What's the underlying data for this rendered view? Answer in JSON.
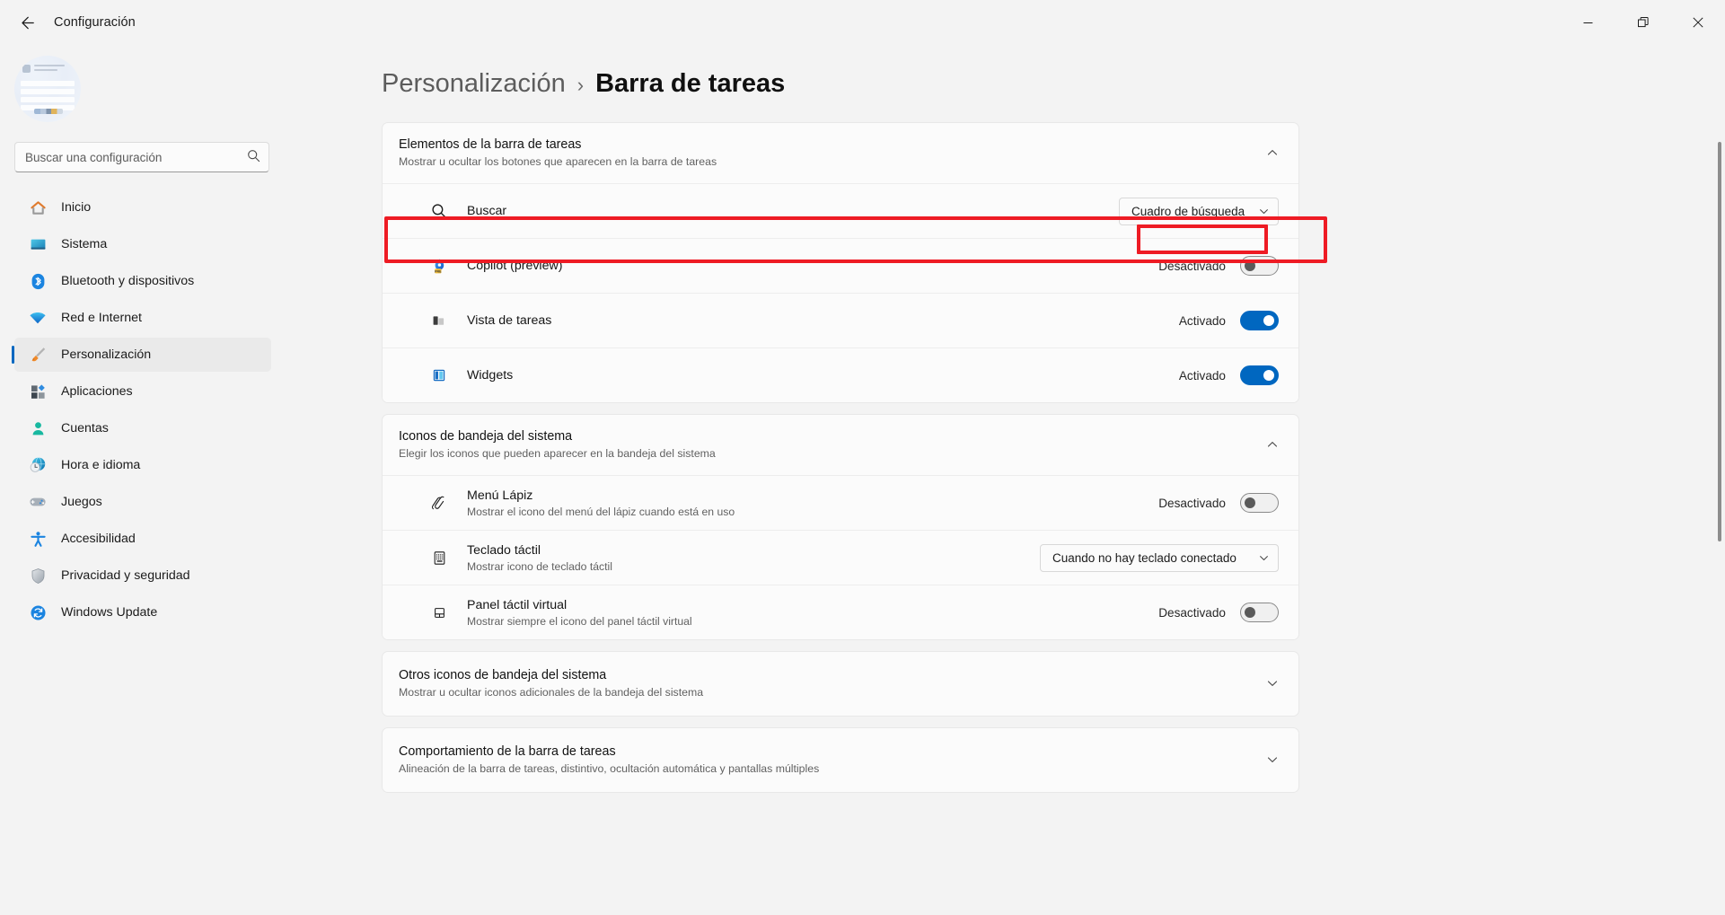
{
  "titlebar": {
    "back_tooltip": "Atrás",
    "app_title": "Configuración",
    "minimize_label": "Minimizar",
    "maximize_label": "Restaurar",
    "close_label": "Cerrar"
  },
  "sidebar": {
    "search_placeholder": "Buscar una configuración",
    "search_value": "",
    "items": [
      {
        "label": "Inicio",
        "icon": "home-icon",
        "active": false
      },
      {
        "label": "Sistema",
        "icon": "display-icon",
        "active": false
      },
      {
        "label": "Bluetooth y dispositivos",
        "icon": "bluetooth-icon",
        "active": false
      },
      {
        "label": "Red e Internet",
        "icon": "wifi-icon",
        "active": false
      },
      {
        "label": "Personalización",
        "icon": "paintbrush-icon",
        "active": true
      },
      {
        "label": "Aplicaciones",
        "icon": "apps-icon",
        "active": false
      },
      {
        "label": "Cuentas",
        "icon": "person-icon",
        "active": false
      },
      {
        "label": "Hora e idioma",
        "icon": "clock-globe-icon",
        "active": false
      },
      {
        "label": "Juegos",
        "icon": "gamepad-icon",
        "active": false
      },
      {
        "label": "Accesibilidad",
        "icon": "accessibility-icon",
        "active": false
      },
      {
        "label": "Privacidad y seguridad",
        "icon": "shield-icon",
        "active": false
      },
      {
        "label": "Windows Update",
        "icon": "update-icon",
        "active": false
      }
    ]
  },
  "breadcrumb": {
    "parent": "Personalización",
    "separator": "›",
    "current": "Barra de tareas"
  },
  "sections": {
    "taskbar_items": {
      "title": "Elementos de la barra de tareas",
      "subtitle": "Mostrar u ocultar los botones que aparecen en la barra de tareas",
      "expanded": true,
      "rows": {
        "search": {
          "title": "Buscar",
          "icon": "search-icon",
          "control": "combo",
          "value": "Cuadro de búsqueda"
        },
        "copilot": {
          "title": "Copilot (preview)",
          "icon": "copilot-icon",
          "control": "toggle",
          "state": "off",
          "state_label": "Desactivado",
          "highlighted": true
        },
        "task_view": {
          "title": "Vista de tareas",
          "icon": "task-view-icon",
          "control": "toggle",
          "state": "on",
          "state_label": "Activado"
        },
        "widgets": {
          "title": "Widgets",
          "icon": "widgets-icon",
          "control": "toggle",
          "state": "on",
          "state_label": "Activado"
        }
      }
    },
    "tray_icons": {
      "title": "Iconos de bandeja del sistema",
      "subtitle": "Elegir los iconos que pueden aparecer en la bandeja del sistema",
      "expanded": true,
      "rows": {
        "pen_menu": {
          "title": "Menú Lápiz",
          "subtitle": "Mostrar el icono del menú del lápiz cuando está en uso",
          "icon": "pen-icon",
          "control": "toggle",
          "state": "off",
          "state_label": "Desactivado"
        },
        "touch_keyboard": {
          "title": "Teclado táctil",
          "subtitle": "Mostrar icono de teclado táctil",
          "icon": "keyboard-icon",
          "control": "combo",
          "value": "Cuando no hay teclado conectado"
        },
        "virtual_touchpad": {
          "title": "Panel táctil virtual",
          "subtitle": "Mostrar siempre el icono del panel táctil virtual",
          "icon": "touchpad-icon",
          "control": "toggle",
          "state": "off",
          "state_label": "Desactivado"
        }
      }
    },
    "other_tray_icons": {
      "title": "Otros iconos de bandeja del sistema",
      "subtitle": "Mostrar u ocultar iconos adicionales de la bandeja del sistema",
      "expanded": false
    },
    "taskbar_behaviors": {
      "title": "Comportamiento de la barra de tareas",
      "subtitle": "Alineación de la barra de tareas, distintivo, ocultación automática y pantallas múltiples",
      "expanded": false
    }
  },
  "colors": {
    "accent": "#0067c0",
    "highlight": "#ee1b24",
    "page_bg": "#f3f3f3",
    "card_bg": "#fbfbfb",
    "selected_nav_bg": "#eaeaea"
  }
}
